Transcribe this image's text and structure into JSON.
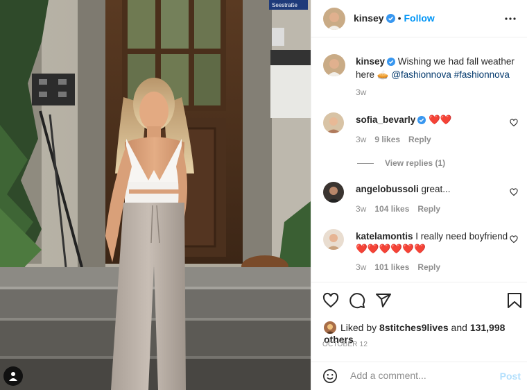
{
  "photo": {
    "street_sign_text": "Seestraße",
    "description_icon": "user-tag-icon"
  },
  "header": {
    "username": "kinsey",
    "separator": "•",
    "follow_label": "Follow",
    "more_icon": "more-options-icon"
  },
  "caption": {
    "username": "kinsey",
    "text": "Wishing we had fall weather here 🥧 ",
    "mention": "@fashionnova",
    "hashtag": "#fashionnova",
    "age": "3w"
  },
  "comments": [
    {
      "username": "sofia_bevarly",
      "text": "❤️❤️",
      "age": "3w",
      "likes": "9 likes",
      "reply": "Reply",
      "verified": true
    },
    {
      "username": "angelobussoli",
      "text": "great...",
      "age": "3w",
      "likes": "104 likes",
      "reply": "Reply",
      "verified": false
    },
    {
      "username": "katelamontis",
      "text": "I really need boyfriend ❤️❤️❤️❤️❤️❤️",
      "age": "3w",
      "likes": "101 likes",
      "reply": "Reply",
      "verified": false
    }
  ],
  "view_replies": "View replies (1)",
  "actions": {
    "liked_by_prefix": "Liked by ",
    "liked_by_user": "8stitches9lives",
    "liked_by_and": " and ",
    "liked_by_count": "131,998 others",
    "date": "OCTOBER 12"
  },
  "add_comment": {
    "placeholder": "Add a comment...",
    "post_label": "Post"
  },
  "colors": {
    "accent": "#0095f6",
    "text": "#262626",
    "muted": "#8e8e8e",
    "heart": "#ed4956",
    "post_disabled": "#b2dffc"
  }
}
